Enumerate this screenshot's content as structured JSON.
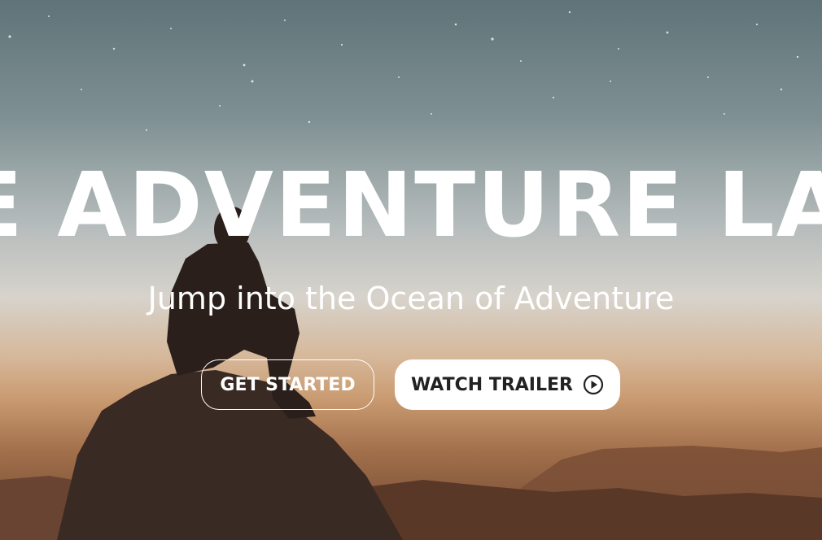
{
  "hero": {
    "headline": "THE ADVENTURE LAND",
    "subtitle": "Jump into the Ocean of Adventure",
    "get_started_label": "GET STARTED",
    "watch_trailer_label": "WATCH TRAILER",
    "play_icon": "play-circle-icon"
  },
  "colors": {
    "text": "#ffffff",
    "button_solid_bg": "#ffffff",
    "button_solid_text": "#222222"
  }
}
